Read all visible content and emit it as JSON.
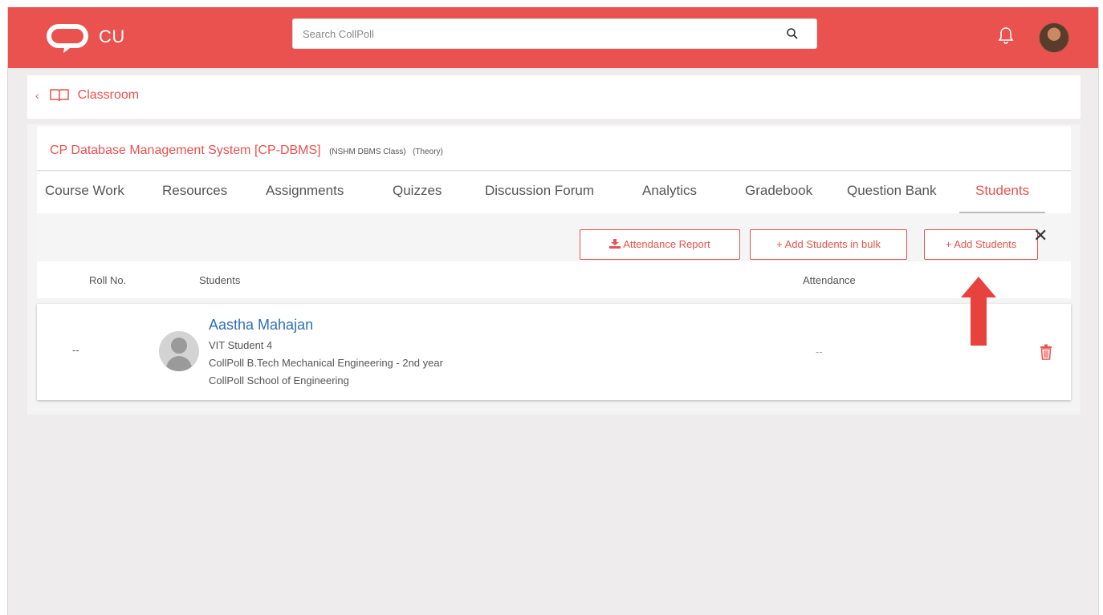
{
  "header": {
    "brand": "CU",
    "search_placeholder": "Search CollPoll",
    "icons": {
      "search": "search-icon",
      "notifications": "bell-icon",
      "avatar": "user-avatar"
    },
    "accent_color": "#e9524f"
  },
  "breadcrumb": {
    "back_icon": "chevron-left-icon",
    "section_icon": "book-icon",
    "label": "Classroom"
  },
  "course": {
    "name": "CP Database Management System [CP-DBMS]",
    "class_name": "(NSHM DBMS Class)",
    "type": "(Theory)"
  },
  "tabs": [
    {
      "label": "Course Work",
      "active": false
    },
    {
      "label": "Resources",
      "active": false
    },
    {
      "label": "Assignments",
      "active": false
    },
    {
      "label": "Quizzes",
      "active": false
    },
    {
      "label": "Discussion Forum",
      "active": false
    },
    {
      "label": "Analytics",
      "active": false
    },
    {
      "label": "Gradebook",
      "active": false
    },
    {
      "label": "Question Bank",
      "active": false
    },
    {
      "label": "Students",
      "active": true
    }
  ],
  "toolbar": {
    "attendance_report": "Attendance Report",
    "add_bulk": "+ Add Students in bulk",
    "add_students": "+ Add Students",
    "close": "✕"
  },
  "table": {
    "headers": {
      "roll": "Roll No.",
      "students": "Students",
      "attendance": "Attendance"
    },
    "rows": [
      {
        "roll": "--",
        "name": "Aastha Mahajan",
        "id": "VIT Student 4",
        "program": "CollPoll B.Tech Mechanical Engineering - 2nd year",
        "school": "CollPoll School of Engineering",
        "attendance": "--"
      }
    ]
  }
}
